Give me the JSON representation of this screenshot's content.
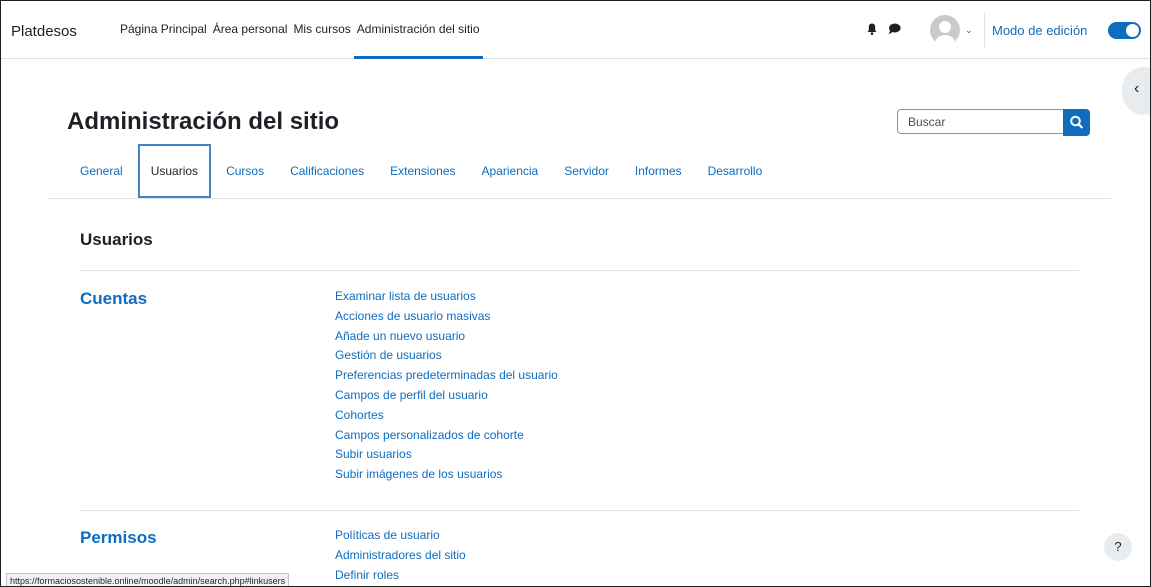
{
  "navbar": {
    "brand": "Platdesos",
    "items": [
      {
        "label": "Página Principal"
      },
      {
        "label": "Área personal"
      },
      {
        "label": "Mis cursos"
      },
      {
        "label": "Administración del sitio"
      }
    ],
    "edit_mode_label": "Modo de edición",
    "edit_mode_on": true
  },
  "header": {
    "title": "Administración del sitio",
    "search_placeholder": "Buscar"
  },
  "tabs": [
    {
      "label": "General"
    },
    {
      "label": "Usuarios"
    },
    {
      "label": "Cursos"
    },
    {
      "label": "Calificaciones"
    },
    {
      "label": "Extensiones"
    },
    {
      "label": "Apariencia"
    },
    {
      "label": "Servidor"
    },
    {
      "label": "Informes"
    },
    {
      "label": "Desarrollo"
    }
  ],
  "active_tab": "Usuarios",
  "section_title": "Usuarios",
  "categories": [
    {
      "heading": "Cuentas",
      "links": [
        "Examinar lista de usuarios",
        "Acciones de usuario masivas",
        "Añade un nuevo usuario",
        "Gestión de usuarios",
        "Preferencias predeterminadas del usuario",
        "Campos de perfil del usuario",
        "Cohortes",
        "Campos personalizados de cohorte",
        "Subir usuarios",
        "Subir imágenes de los usuarios"
      ]
    },
    {
      "heading": "Permisos",
      "links": [
        "Políticas de usuario",
        "Administradores del sitio",
        "Definir roles"
      ]
    }
  ],
  "help_label": "?",
  "status_url": "https://formaciosostenible.online/moodle/admin/search.php#linkusers",
  "colors": {
    "accent": "#0f6cbf",
    "text": "#1d2125",
    "border": "#dee2e6"
  }
}
